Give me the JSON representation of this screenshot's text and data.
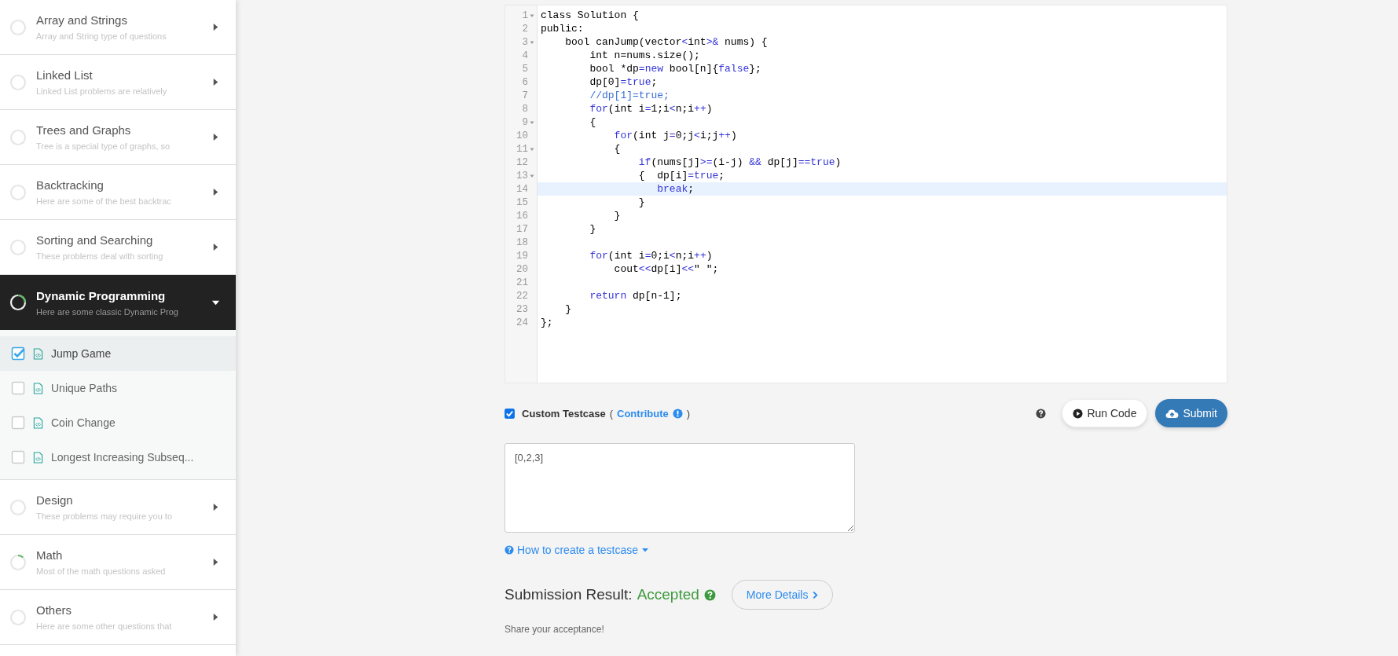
{
  "sidebar": {
    "categories": [
      {
        "title": "Array and Strings",
        "description": "Array and String type of questions",
        "expanded": false,
        "level": 0
      },
      {
        "title": "Linked List",
        "description": "Linked List problems are relatively",
        "expanded": false,
        "level": 0
      },
      {
        "title": "Trees and Graphs",
        "description": "Tree is a special type of graphs, so",
        "expanded": false,
        "level": 0
      },
      {
        "title": "Backtracking",
        "description": "Here are some of the best backtrac",
        "expanded": false,
        "level": 0
      },
      {
        "title": "Sorting and Searching",
        "description": "These problems deal with sorting",
        "expanded": false,
        "level": 0
      },
      {
        "title": "Dynamic Programming",
        "description": "Here are some classic Dynamic Prog",
        "expanded": true,
        "level": 0.25,
        "children": [
          {
            "title": "Jump Game",
            "checked": true,
            "selected": true
          },
          {
            "title": "Unique Paths",
            "checked": false,
            "selected": false
          },
          {
            "title": "Coin Change",
            "checked": false,
            "selected": false
          },
          {
            "title": "Longest Increasing Subseq...",
            "checked": false,
            "selected": false
          }
        ]
      },
      {
        "title": "Design",
        "description": "These problems may require you to",
        "expanded": false,
        "level": 0
      },
      {
        "title": "Math",
        "description": "Most of the math questions asked",
        "expanded": false,
        "level": 0.12
      },
      {
        "title": "Others",
        "description": "Here are some other questions that",
        "expanded": false,
        "level": 0
      }
    ]
  },
  "editor": {
    "lines": [
      {
        "number": "1",
        "fold": true,
        "active": false,
        "tokens": [
          {
            "kind": "plain",
            "text": "class Solution {"
          }
        ]
      },
      {
        "number": "2",
        "fold": false,
        "active": false,
        "tokens": [
          {
            "kind": "plain",
            "text": "public:"
          }
        ]
      },
      {
        "number": "3",
        "fold": true,
        "active": false,
        "tokens": [
          {
            "kind": "plain",
            "text": "    bool canJump(vector"
          },
          {
            "kind": "keyword",
            "text": "<"
          },
          {
            "kind": "plain",
            "text": "int"
          },
          {
            "kind": "keyword",
            "text": ">&"
          },
          {
            "kind": "plain",
            "text": " nums) {"
          }
        ]
      },
      {
        "number": "4",
        "fold": false,
        "active": false,
        "tokens": [
          {
            "kind": "plain",
            "text": "        int n=nums.size();"
          }
        ]
      },
      {
        "number": "5",
        "fold": false,
        "active": false,
        "tokens": [
          {
            "kind": "plain",
            "text": "        bool *dp"
          },
          {
            "kind": "keyword",
            "text": "=new"
          },
          {
            "kind": "plain",
            "text": " bool[n]{"
          },
          {
            "kind": "keyword",
            "text": "false"
          },
          {
            "kind": "plain",
            "text": "};"
          }
        ]
      },
      {
        "number": "6",
        "fold": false,
        "active": false,
        "tokens": [
          {
            "kind": "plain",
            "text": "        dp[0]"
          },
          {
            "kind": "keyword",
            "text": "=true"
          },
          {
            "kind": "plain",
            "text": ";"
          }
        ]
      },
      {
        "number": "7",
        "fold": false,
        "active": false,
        "tokens": [
          {
            "kind": "comment",
            "text": "        //dp[1]=true;"
          }
        ]
      },
      {
        "number": "8",
        "fold": false,
        "active": false,
        "tokens": [
          {
            "kind": "keyword",
            "text": "        for"
          },
          {
            "kind": "plain",
            "text": "(int i"
          },
          {
            "kind": "keyword",
            "text": "="
          },
          {
            "kind": "plain",
            "text": "1;i"
          },
          {
            "kind": "keyword",
            "text": "<"
          },
          {
            "kind": "plain",
            "text": "n;i"
          },
          {
            "kind": "keyword",
            "text": "++"
          },
          {
            "kind": "plain",
            "text": ")"
          }
        ]
      },
      {
        "number": "9",
        "fold": true,
        "active": false,
        "tokens": [
          {
            "kind": "plain",
            "text": "        {"
          }
        ]
      },
      {
        "number": "10",
        "fold": false,
        "active": false,
        "tokens": [
          {
            "kind": "keyword",
            "text": "            for"
          },
          {
            "kind": "plain",
            "text": "(int j"
          },
          {
            "kind": "keyword",
            "text": "="
          },
          {
            "kind": "plain",
            "text": "0;j"
          },
          {
            "kind": "keyword",
            "text": "<"
          },
          {
            "kind": "plain",
            "text": "i;j"
          },
          {
            "kind": "keyword",
            "text": "++"
          },
          {
            "kind": "plain",
            "text": ")"
          }
        ]
      },
      {
        "number": "11",
        "fold": true,
        "active": false,
        "tokens": [
          {
            "kind": "plain",
            "text": "            {"
          }
        ]
      },
      {
        "number": "12",
        "fold": false,
        "active": false,
        "tokens": [
          {
            "kind": "keyword",
            "text": "                if"
          },
          {
            "kind": "plain",
            "text": "(nums[j]"
          },
          {
            "kind": "keyword",
            "text": ">="
          },
          {
            "kind": "plain",
            "text": "(i-j) "
          },
          {
            "kind": "keyword",
            "text": "&&"
          },
          {
            "kind": "plain",
            "text": " dp[j]"
          },
          {
            "kind": "keyword",
            "text": "==true"
          },
          {
            "kind": "plain",
            "text": ")"
          }
        ]
      },
      {
        "number": "13",
        "fold": true,
        "active": false,
        "tokens": [
          {
            "kind": "plain",
            "text": "                {  dp[i]"
          },
          {
            "kind": "keyword",
            "text": "=true"
          },
          {
            "kind": "plain",
            "text": ";"
          }
        ]
      },
      {
        "number": "14",
        "fold": false,
        "active": true,
        "tokens": [
          {
            "kind": "keyword",
            "text": "                   break"
          },
          {
            "kind": "plain",
            "text": ";"
          }
        ]
      },
      {
        "number": "15",
        "fold": false,
        "active": false,
        "tokens": [
          {
            "kind": "plain",
            "text": "                }"
          }
        ]
      },
      {
        "number": "16",
        "fold": false,
        "active": false,
        "tokens": [
          {
            "kind": "plain",
            "text": "            }"
          }
        ]
      },
      {
        "number": "17",
        "fold": false,
        "active": false,
        "tokens": [
          {
            "kind": "plain",
            "text": "        }"
          }
        ]
      },
      {
        "number": "18",
        "fold": false,
        "active": false
      },
      {
        "number": "19",
        "fold": false,
        "active": false,
        "tokens": [
          {
            "kind": "keyword",
            "text": "        for"
          },
          {
            "kind": "plain",
            "text": "(int i"
          },
          {
            "kind": "keyword",
            "text": "="
          },
          {
            "kind": "plain",
            "text": "0;i"
          },
          {
            "kind": "keyword",
            "text": "<"
          },
          {
            "kind": "plain",
            "text": "n;i"
          },
          {
            "kind": "keyword",
            "text": "++"
          },
          {
            "kind": "plain",
            "text": ")"
          }
        ]
      },
      {
        "number": "20",
        "fold": false,
        "active": false,
        "tokens": [
          {
            "kind": "plain",
            "text": "            cout"
          },
          {
            "kind": "keyword",
            "text": "<<"
          },
          {
            "kind": "plain",
            "text": "dp[i]"
          },
          {
            "kind": "keyword",
            "text": "<<"
          },
          {
            "kind": "plain",
            "text": "\" \";"
          }
        ]
      },
      {
        "number": "21",
        "fold": false,
        "active": false
      },
      {
        "number": "22",
        "fold": false,
        "active": false,
        "tokens": [
          {
            "kind": "keyword",
            "text": "        return"
          },
          {
            "kind": "plain",
            "text": " dp[n-1];"
          }
        ]
      },
      {
        "number": "23",
        "fold": false,
        "active": false,
        "tokens": [
          {
            "kind": "plain",
            "text": "    }"
          }
        ]
      },
      {
        "number": "24",
        "fold": false,
        "active": false,
        "tokens": [
          {
            "kind": "plain",
            "text": "};"
          }
        ]
      }
    ]
  },
  "testcase": {
    "checked": true,
    "label": "Custom Testcase",
    "paren_open": "(",
    "link": "Contribute",
    "paren_close": ")",
    "value": "[0,2,3]",
    "help_link": "How to create a testcase"
  },
  "buttons": {
    "run": "Run Code",
    "submit": "Submit"
  },
  "result": {
    "label": "Submission Result:",
    "status": "Accepted",
    "details": "More Details",
    "share": "Share your acceptance!"
  }
}
